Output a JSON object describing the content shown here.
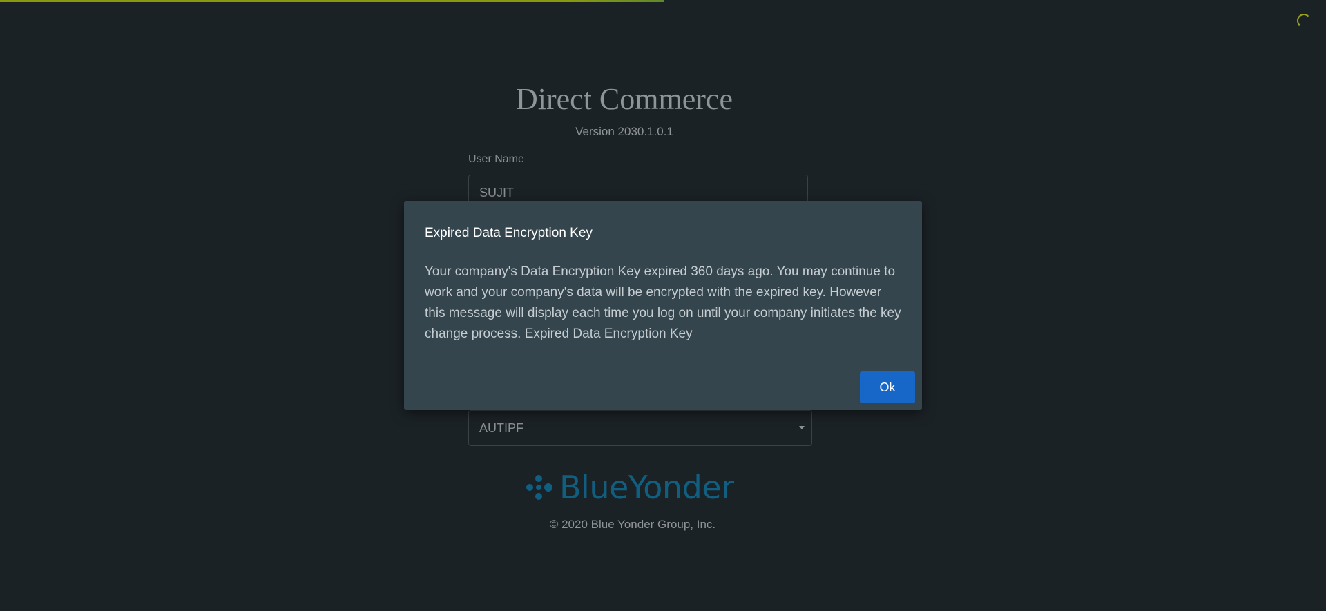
{
  "app": {
    "title": "Direct Commerce",
    "version": "Version 2030.1.0.1",
    "copyright": "© 2020 Blue Yonder Group, Inc."
  },
  "form": {
    "username_label": "User Name",
    "username_value": "SUJIT",
    "company_value": "AUTIPF"
  },
  "brand": {
    "name": "BlueYonder",
    "color": "#115f80"
  },
  "dialog": {
    "title": "Expired Data Encryption Key",
    "message": "Your company's Data Encryption Key expired 360 days ago. You may continue to work and your company's data will be encrypted with the expired key. However this message will display each time you log on until your company initiates the key change process. Expired Data Encryption Key",
    "ok_label": "Ok",
    "button_color": "#1767c8"
  },
  "status": {
    "loading_spinner_icon": "spinner-icon",
    "page_load_progress": 0.5
  }
}
